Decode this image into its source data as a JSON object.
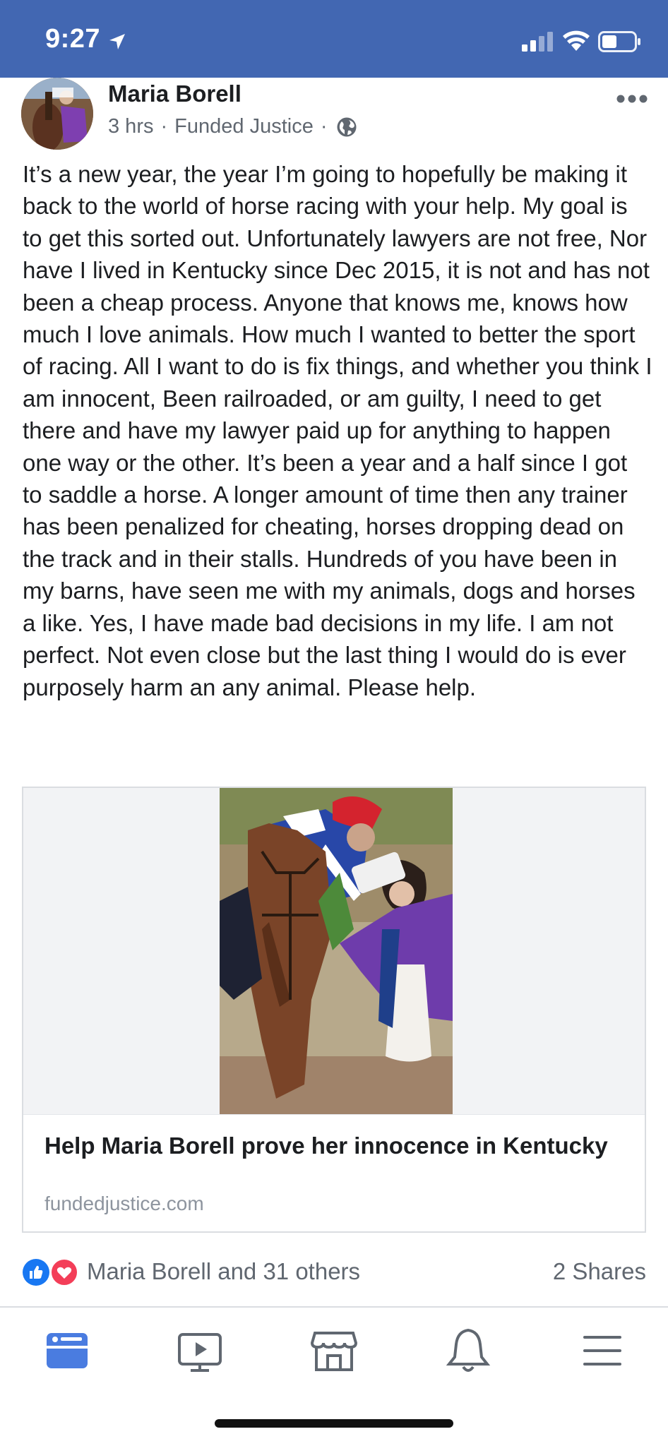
{
  "status_bar": {
    "time": "9:27",
    "bg_color": "#4267b2",
    "icons": [
      "location-arrow-icon",
      "cellular-signal-icon",
      "wifi-icon",
      "battery-icon"
    ]
  },
  "post": {
    "author": "Maria Borell",
    "time_ago": "3 hrs",
    "separator": "·",
    "via": "Funded Justice",
    "privacy_icon": "globe-icon",
    "more_icon": "more-options-icon",
    "text": "It’s a new year, the year I’m going to hopefully be making it back to the world of horse racing with your help. My goal is to get this sorted out. Unfortunately lawyers are not free, Nor have I lived in Kentucky since Dec 2015, it is not and has not been a cheap process. Anyone that knows me, knows how much I love animals. How much I wanted to better the sport of racing. All I want to do is fix things, and whether you think I am innocent, Been railroaded, or am guilty, I need to get there and have my lawyer paid up for anything to happen one way or the other. It’s been a year and a half since I got to saddle a horse. A longer amount of time then any trainer has been penalized for cheating, horses dropping dead on the track and in their stalls. Hundreds of you have been in my barns, have seen me with my animals, dogs and horses a like. Yes, I have made bad decisions in my life. I am not perfect. Not even close but the last thing I would do is ever purposely harm an any animal. Please help."
  },
  "link_card": {
    "title": "Help Maria Borell prove her innocence in Kentucky",
    "domain": "fundedjustice.com"
  },
  "reactions": {
    "icons": [
      "like-icon",
      "love-icon"
    ],
    "summary": "Maria Borell and 31 others",
    "shares": "2 Shares",
    "like_color": "#1877f2",
    "love_color": "#f33e58"
  },
  "tab_bar": {
    "tabs": [
      "news-feed-tab",
      "watch-tab",
      "marketplace-tab",
      "notifications-tab",
      "menu-tab"
    ],
    "active": "news-feed-tab",
    "active_color": "#4a7ce0",
    "inactive_color": "#606770"
  }
}
